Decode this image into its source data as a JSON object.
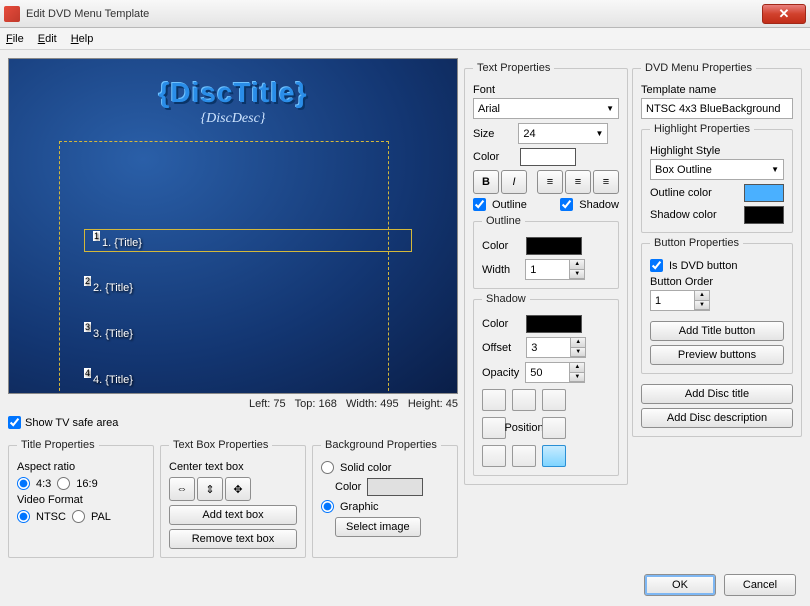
{
  "window": {
    "title": "Edit DVD Menu Template"
  },
  "menubar": {
    "file": "File",
    "edit": "Edit",
    "help": "Help"
  },
  "preview": {
    "disc_title": "{DiscTitle}",
    "disc_desc": "{DiscDesc}",
    "t1": "1. {Title}",
    "t2": "2. {Title}",
    "t3": "3. {Title}",
    "t4": "4. {Title}"
  },
  "status": {
    "left_label": "Left:",
    "left": "75",
    "top_label": "Top:",
    "top": "168",
    "width_label": "Width:",
    "width": "495",
    "height_label": "Height:",
    "height": "45"
  },
  "show_tv": "Show TV safe area",
  "title_props": {
    "legend": "Title Properties",
    "aspect_label": "Aspect ratio",
    "aspect_43": "4:3",
    "aspect_169": "16:9",
    "video_label": "Video Format",
    "ntsc": "NTSC",
    "pal": "PAL"
  },
  "textbox_props": {
    "legend": "Text Box Properties",
    "center_label": "Center text box",
    "add": "Add text box",
    "remove": "Remove text box"
  },
  "bg_props": {
    "legend": "Background Properties",
    "solid": "Solid color",
    "color_label": "Color",
    "graphic": "Graphic",
    "select": "Select image"
  },
  "text_props": {
    "legend": "Text Properties",
    "font_label": "Font",
    "font": "Arial",
    "size_label": "Size",
    "size": "24",
    "color_label": "Color",
    "outline_chk": "Outline",
    "shadow_chk": "Shadow",
    "outline_legend": "Outline",
    "outline_color_label": "Color",
    "outline_width_label": "Width",
    "outline_width": "1",
    "shadow_legend": "Shadow",
    "shadow_color_label": "Color",
    "shadow_offset_label": "Offset",
    "shadow_offset": "3",
    "shadow_opacity_label": "Opacity",
    "shadow_opacity": "50",
    "position_label": "Position"
  },
  "dvd_props": {
    "legend": "DVD Menu Properties",
    "template_label": "Template name",
    "template_name": "NTSC 4x3 BlueBackground",
    "highlight_legend": "Highlight Properties",
    "highlight_style_label": "Highlight Style",
    "highlight_style": "Box Outline",
    "outline_color_label": "Outline color",
    "shadow_color_label": "Shadow color",
    "button_legend": "Button Properties",
    "is_dvd": "Is DVD button",
    "order_label": "Button Order",
    "order": "1",
    "add_title_btn": "Add Title button",
    "preview_btn": "Preview buttons",
    "add_disc_title": "Add Disc title",
    "add_disc_desc": "Add Disc description"
  },
  "footer": {
    "ok": "OK",
    "cancel": "Cancel"
  }
}
